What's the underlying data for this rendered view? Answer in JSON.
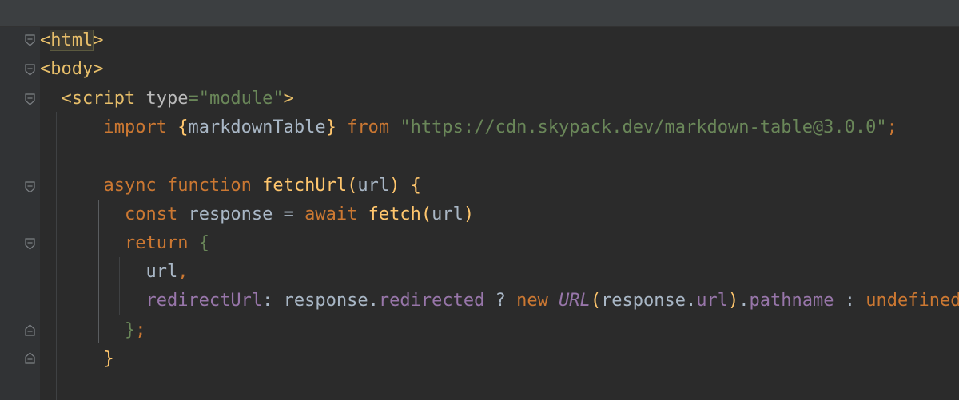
{
  "editor": {
    "lines": [
      {
        "tokens": [
          {
            "t": "<",
            "c": "tag"
          },
          {
            "t": "html",
            "c": "tag hl"
          },
          {
            "t": ">",
            "c": "tag"
          }
        ]
      },
      {
        "tokens": [
          {
            "t": "<body>",
            "c": "tag"
          }
        ]
      },
      {
        "tokens": [
          {
            "t": "  ",
            "c": ""
          },
          {
            "t": "<script ",
            "c": "tag"
          },
          {
            "t": "type",
            "c": "attr"
          },
          {
            "t": "=\"module\"",
            "c": "str"
          },
          {
            "t": ">",
            "c": "tag"
          }
        ]
      },
      {
        "tokens": [
          {
            "t": "      ",
            "c": ""
          },
          {
            "t": "import ",
            "c": "kw"
          },
          {
            "t": "{",
            "c": "fn"
          },
          {
            "t": "markdownTable",
            "c": ""
          },
          {
            "t": "} ",
            "c": "fn"
          },
          {
            "t": "from ",
            "c": "kw"
          },
          {
            "t": "\"https://cdn.skypack.dev/markdown-table@3.0.0\"",
            "c": "str"
          },
          {
            "t": ";",
            "c": "kw"
          }
        ]
      },
      {
        "tokens": []
      },
      {
        "tokens": [
          {
            "t": "      ",
            "c": ""
          },
          {
            "t": "async function ",
            "c": "kw"
          },
          {
            "t": "fetchUrl",
            "c": "fn"
          },
          {
            "t": "(",
            "c": "fn"
          },
          {
            "t": "url",
            "c": ""
          },
          {
            "t": ") {",
            "c": "fn"
          }
        ]
      },
      {
        "tokens": [
          {
            "t": "        ",
            "c": ""
          },
          {
            "t": "const ",
            "c": "kw"
          },
          {
            "t": "response ",
            "c": ""
          },
          {
            "t": "= ",
            "c": ""
          },
          {
            "t": "await ",
            "c": "kw"
          },
          {
            "t": "fetch",
            "c": "fn"
          },
          {
            "t": "(",
            "c": "fn"
          },
          {
            "t": "url",
            "c": ""
          },
          {
            "t": ")",
            "c": "fn"
          }
        ]
      },
      {
        "tokens": [
          {
            "t": "        ",
            "c": ""
          },
          {
            "t": "return ",
            "c": "kw"
          },
          {
            "t": "{",
            "c": "str"
          }
        ]
      },
      {
        "tokens": [
          {
            "t": "          ",
            "c": ""
          },
          {
            "t": "url",
            "c": ""
          },
          {
            "t": ",",
            "c": "kw"
          }
        ]
      },
      {
        "tokens": [
          {
            "t": "          ",
            "c": ""
          },
          {
            "t": "redirectUrl",
            "c": "prop"
          },
          {
            "t": ": ",
            "c": ""
          },
          {
            "t": "response",
            "c": ""
          },
          {
            "t": ".",
            "c": ""
          },
          {
            "t": "redirected",
            "c": "prop"
          },
          {
            "t": " ? ",
            "c": ""
          },
          {
            "t": "new ",
            "c": "kw"
          },
          {
            "t": "URL",
            "c": "cls"
          },
          {
            "t": "(",
            "c": "fn"
          },
          {
            "t": "response",
            "c": ""
          },
          {
            "t": ".",
            "c": ""
          },
          {
            "t": "url",
            "c": "prop"
          },
          {
            "t": ")",
            "c": "fn"
          },
          {
            "t": ".",
            "c": ""
          },
          {
            "t": "pathname",
            "c": "prop"
          },
          {
            "t": " : ",
            "c": ""
          },
          {
            "t": "undefined",
            "c": "kw"
          }
        ]
      },
      {
        "tokens": [
          {
            "t": "        ",
            "c": ""
          },
          {
            "t": "}",
            "c": "str"
          },
          {
            "t": ";",
            "c": "kw"
          }
        ]
      },
      {
        "tokens": [
          {
            "t": "      ",
            "c": ""
          },
          {
            "t": "}",
            "c": "fn"
          }
        ]
      }
    ]
  },
  "icons": {
    "fold_open": "fold-open-icon",
    "fold_close": "fold-close-icon"
  },
  "colors": {
    "background": "#2b2b2b",
    "gutter": "#313335",
    "tag": "#e8bf6a",
    "string": "#6a8759",
    "keyword": "#cc7832",
    "function": "#ffc66d",
    "property": "#9876aa",
    "text": "#a9b7c6"
  }
}
